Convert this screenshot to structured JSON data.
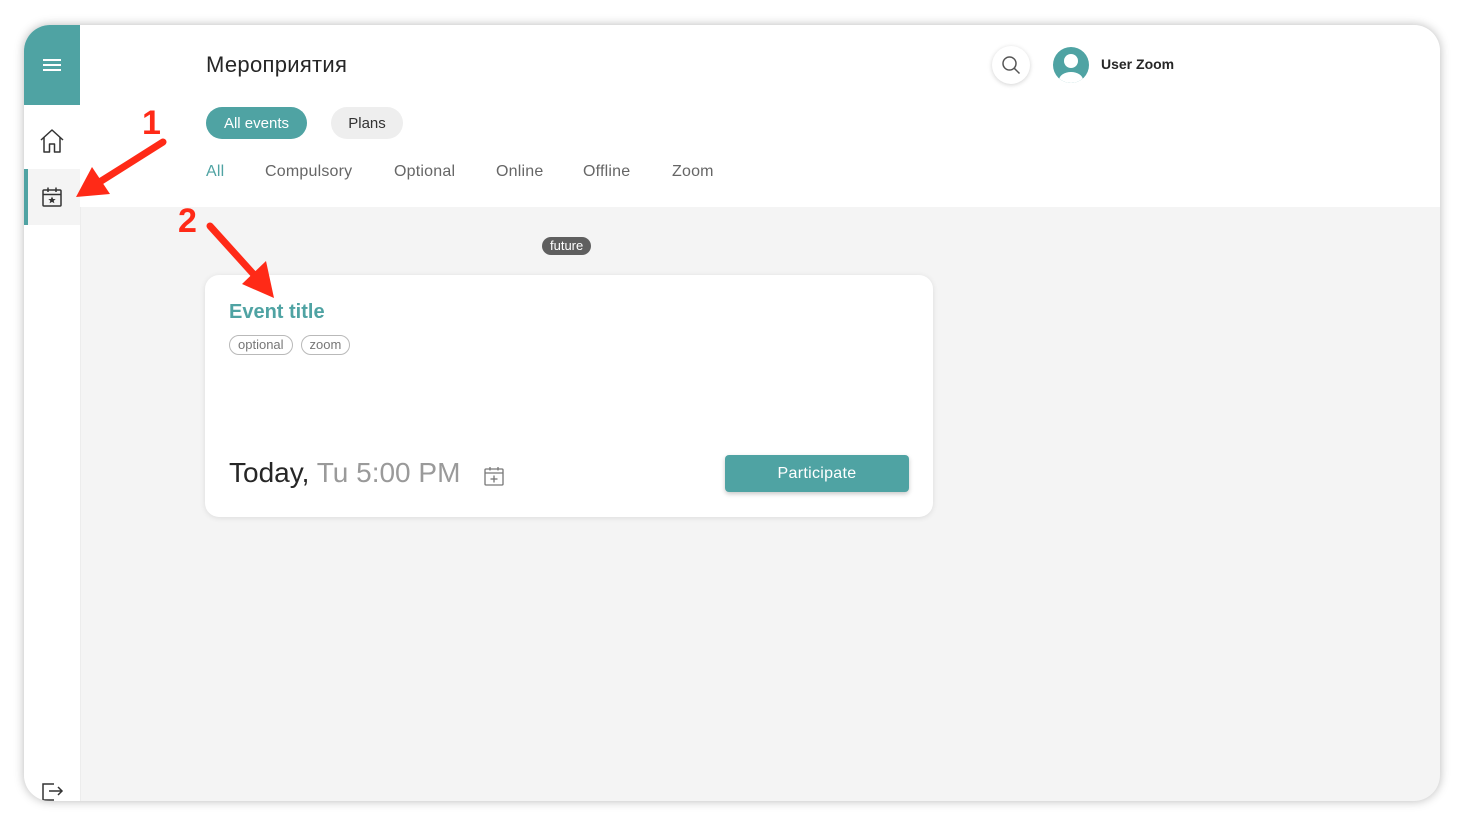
{
  "app": {
    "page_title": "Мероприятия"
  },
  "header": {
    "user_name": "User Zoom",
    "scopes": [
      "All events",
      "Plans"
    ],
    "active_scope": "All events",
    "filters": [
      "All",
      "Compulsory",
      "Optional",
      "Online",
      "Offline",
      "Zoom"
    ],
    "active_filter": "All"
  },
  "sidebar": {
    "items": [
      {
        "icon": "menu-icon"
      },
      {
        "icon": "home-icon"
      },
      {
        "icon": "calendar-star-icon",
        "active": true
      },
      {
        "icon": "logout-icon"
      }
    ]
  },
  "events": {
    "group_badge": "future",
    "items": [
      {
        "title": "Event title",
        "tags": [
          "optional",
          "zoom"
        ],
        "day": "Today,",
        "time": "Tu 5:00 PM",
        "action_label": "Participate"
      }
    ]
  },
  "annotations": [
    {
      "number": "1"
    },
    {
      "number": "2"
    }
  ],
  "colors": {
    "accent": "#4fa3a3",
    "annotation": "#ff2a17",
    "background": "#f4f4f4"
  }
}
